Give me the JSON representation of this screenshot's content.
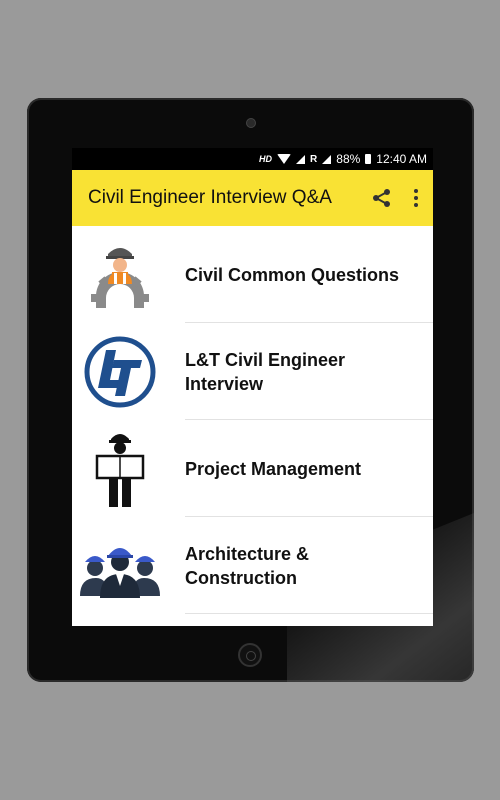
{
  "statusbar": {
    "network": "HD",
    "roaming": "R",
    "battery": "88%",
    "time": "12:40 AM"
  },
  "appbar": {
    "title": "Civil Engineer Interview Q&A",
    "actions": [
      "share-icon",
      "more-vert-icon"
    ]
  },
  "list": {
    "items": [
      {
        "label": "Civil Common Questions",
        "icon": "engineer-gear-icon"
      },
      {
        "label": "L&T Civil Engineer Interview",
        "icon": "lt-logo-icon"
      },
      {
        "label": "Project Management",
        "icon": "worker-blueprint-icon"
      },
      {
        "label": "Architecture & Construction",
        "icon": "team-helmets-icon"
      }
    ]
  },
  "colors": {
    "appbar": "#f9e234",
    "accent_orange": "#f08a24",
    "lt_blue": "#1f4f8e"
  }
}
